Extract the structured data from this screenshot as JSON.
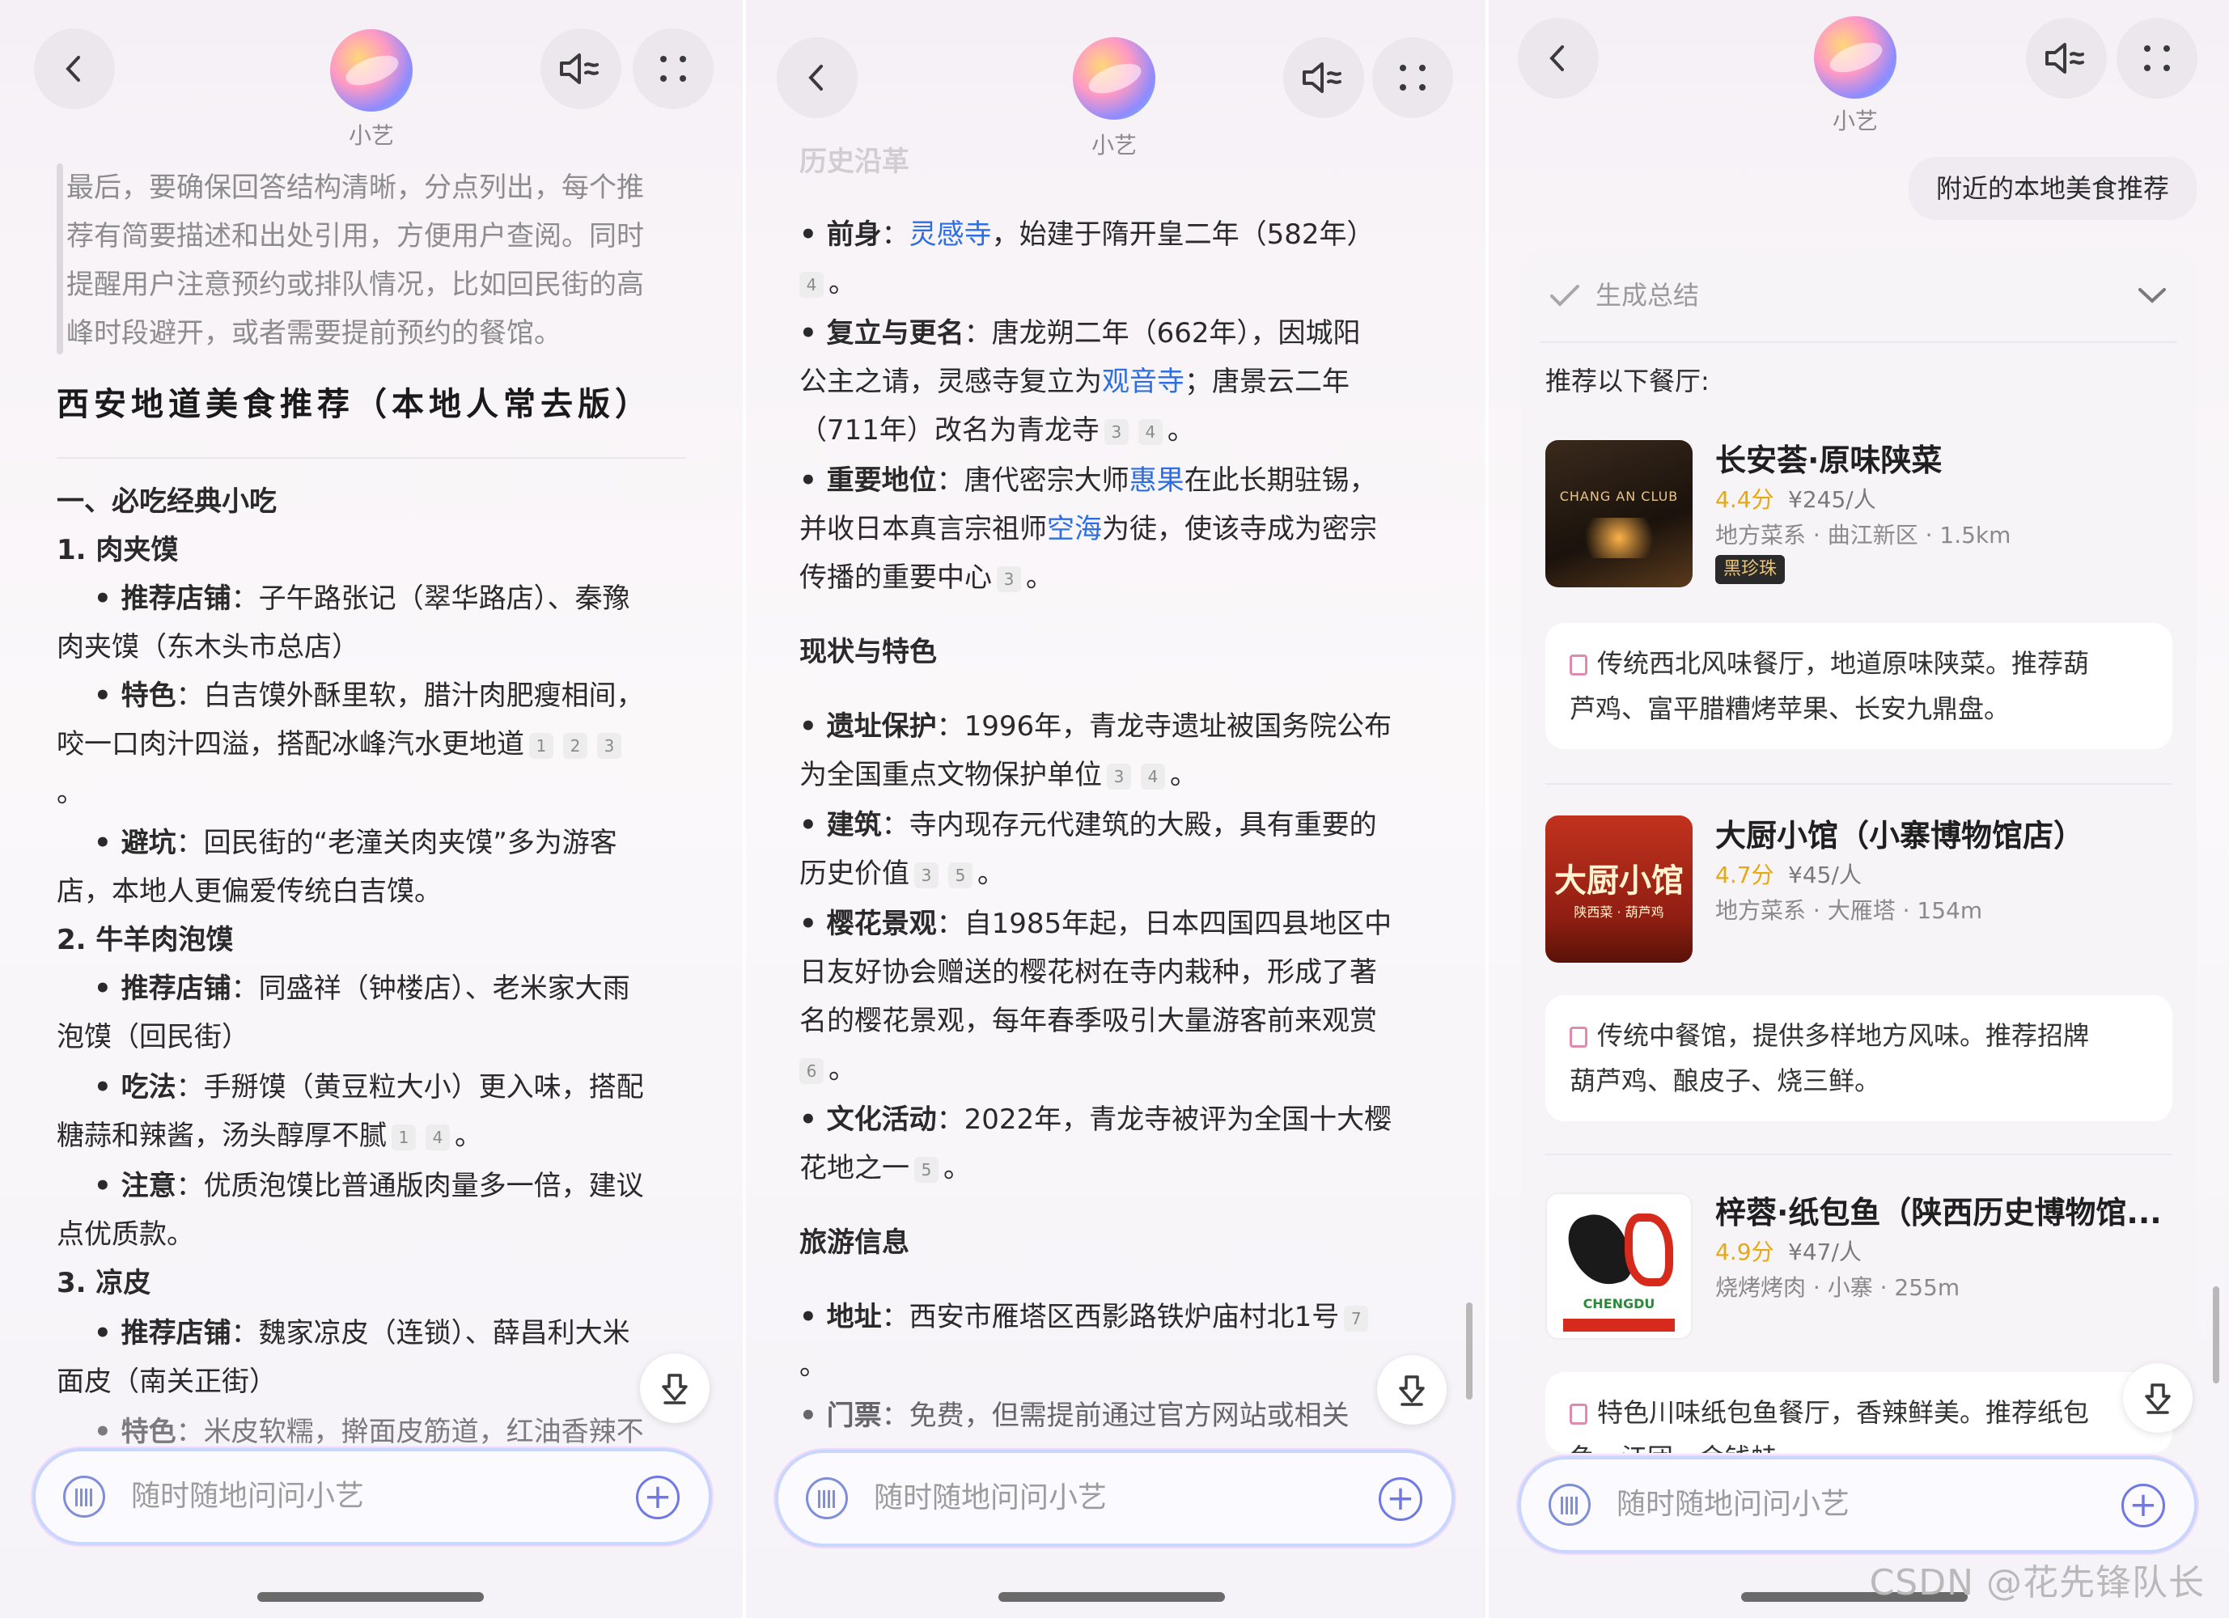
{
  "assistant_name": "小艺",
  "input_placeholder": "随时随地问问小艺",
  "watermark": "CSDN @花先锋队长",
  "p1": {
    "intro_lines": [
      "最后，要确保回答结构清晰，分点列出，每个推",
      "荐有简要描述和出处引用，方便用户查阅。同时",
      "提醒用户注意预约或排队情况，比如回民街的高",
      "峰时段避开，或者需要提前预约的餐馆。"
    ],
    "title": "西安地道美食推荐（本地人常去版）",
    "section1": "一、必吃经典小吃",
    "item1": "1. 肉夹馍",
    "i1_shop_label": "• 推荐店铺",
    "i1_shop_l1": "：子午路张记（翠华路店）、秦豫",
    "i1_shop_l2": "肉夹馍（东木头市总店）",
    "i1_feat_label": "• 特色",
    "i1_feat_l1": "：白吉馍外酥里软，腊汁肉肥瘦相间，",
    "i1_feat_l2": "咬一口肉汁四溢，搭配冰峰汽水更地道",
    "i1_feat_c1": "1",
    "i1_feat_c2": "2",
    "i1_feat_c3": "3",
    "i1_dot": "。",
    "i1_avoid_label": "• 避坑",
    "i1_avoid_l1": "：回民街的“老潼关肉夹馍”多为游客",
    "i1_avoid_l2": "店，本地人更偏爱传统白吉馍。",
    "item2": "2. 牛羊肉泡馍",
    "i2_shop_label": "• 推荐店铺",
    "i2_shop_l1": "：同盛祥（钟楼店）、老米家大雨",
    "i2_shop_l2": "泡馍（回民街）",
    "i2_eat_label": "• 吃法",
    "i2_eat_l1": "：手掰馍（黄豆粒大小）更入味，搭配",
    "i2_eat_l2": "糖蒜和辣酱，汤头醇厚不腻",
    "i2_eat_c1": "1",
    "i2_eat_c2": "4",
    "i2_eat_end": "。",
    "i2_note_label": "• 注意",
    "i2_note_l1": "：优质泡馍比普通版肉量多一倍，建议",
    "i2_note_l2": "点优质款。",
    "item3": "3. 凉皮",
    "i3_shop_label": "• 推荐店铺",
    "i3_shop_l1": "：魏家凉皮（连锁）、薛昌利大米",
    "i3_shop_l2": "面皮（南关正街）",
    "i3_feat_label": "• 特色",
    "i3_feat_l1": "：米皮软糯，擀面皮筋道，红油香辣不"
  },
  "p2": {
    "top_faded": "历史沿革",
    "l_pre_label": "• 前身",
    "l_pre_a": "：",
    "l_pre_link": "灵感寺",
    "l_pre_b": "，始建于隋开皇二年（582年）",
    "l_pre_c1": "4",
    "l_pre_end": "。",
    "l_re_label": "• 复立与更名",
    "l_re_l1": "：唐龙朔二年（662年），因城阳",
    "l_re_l2a": "公主之请，灵感寺复立为",
    "l_re_link": "观音寺",
    "l_re_l2b": "；唐景云二年",
    "l_re_l3": "（711年）改名为青龙寺",
    "l_re_c1": "3",
    "l_re_c2": "4",
    "l_re_end": "。",
    "l_imp_label": "• 重要地位",
    "l_imp_l1a": "：唐代密宗大师",
    "l_imp_link1": "惠果",
    "l_imp_l1b": "在此长期驻锡，",
    "l_imp_l2a": "并收日本真言宗祖师",
    "l_imp_link2": "空海",
    "l_imp_l2b": "为徒，使该寺成为密宗",
    "l_imp_l3": "传播的重要中心",
    "l_imp_c1": "3",
    "l_imp_end": "。",
    "sec_status": "现状与特色",
    "l_site_label": "• 遗址保护",
    "l_site_l1": "：1996年，青龙寺遗址被国务院公布",
    "l_site_l2": "为全国重点文物保护单位",
    "l_site_c1": "3",
    "l_site_c2": "4",
    "l_site_end": "。",
    "l_arch_label": "• 建筑",
    "l_arch_l1": "：寺内现存元代建筑的大殿，具有重要的",
    "l_arch_l2": "历史价值",
    "l_arch_c1": "3",
    "l_arch_c2": "5",
    "l_arch_end": "。",
    "l_cherry_label": "• 樱花景观",
    "l_cherry_l1": "：自1985年起，日本四国四县地区中",
    "l_cherry_l2": "日友好协会赠送的樱花树在寺内栽种，形成了著",
    "l_cherry_l3": "名的樱花景观，每年春季吸引大量游客前来观赏",
    "l_cherry_c1": "6",
    "l_cherry_end": "。",
    "l_cult_label": "• 文化活动",
    "l_cult_l1": "：2022年，青龙寺被评为全国十大樱",
    "l_cult_l2": "花地之一",
    "l_cult_c1": "5",
    "l_cult_end": "。",
    "sec_travel": "旅游信息",
    "l_addr_label": "• 地址",
    "l_addr_l1": "：西安市雁塔区西影路铁炉庙村北1号",
    "l_addr_c1": "7",
    "l_addr_end": "。",
    "l_ticket_label": "• 门票",
    "l_ticket_l1": "：免费，但需提前通过官方网站或相关"
  },
  "p3": {
    "user_message": "附近的本地美食推荐",
    "summary_label": "生成总结",
    "recommend_label": "推荐以下餐厅:",
    "restaurants": [
      {
        "name": "长安荟·原味陕菜",
        "score": "4.4分",
        "price": "¥245/人",
        "meta": "地方菜系 · 曲江新区 · 1.5km",
        "tag": "黑珍珠",
        "thumb_text": "CHANG AN CLUB",
        "desc_l1": "传统西北风味餐厅，地道原味陕菜。推荐葫",
        "desc_l2": "芦鸡、富平腊糟烤苹果、长安九鼎盘。"
      },
      {
        "name": "大厨小馆（小寨博物馆店）",
        "score": "4.7分",
        "price": "¥45/人",
        "meta": "地方菜系 · 大雁塔 · 154m",
        "thumb_text": "大厨小馆",
        "thumb_sub": "陕西菜 · 葫芦鸡",
        "desc_l1": "传统中餐馆，提供多样地方风味。推荐招牌",
        "desc_l2": "葫芦鸡、酿皮子、烧三鲜。"
      },
      {
        "name": "梓蓉·纸包鱼（陕西历史博物馆...",
        "score": "4.9分",
        "price": "¥47/人",
        "meta": "烧烤烤肉 · 小寨 · 255m",
        "thumb_text": "CHENGDU",
        "desc_l1": "特色川味纸包鱼餐厅，香辣鲜美。推荐纸包",
        "desc_l2": "鱼、江团、金钱蛙..."
      }
    ]
  }
}
